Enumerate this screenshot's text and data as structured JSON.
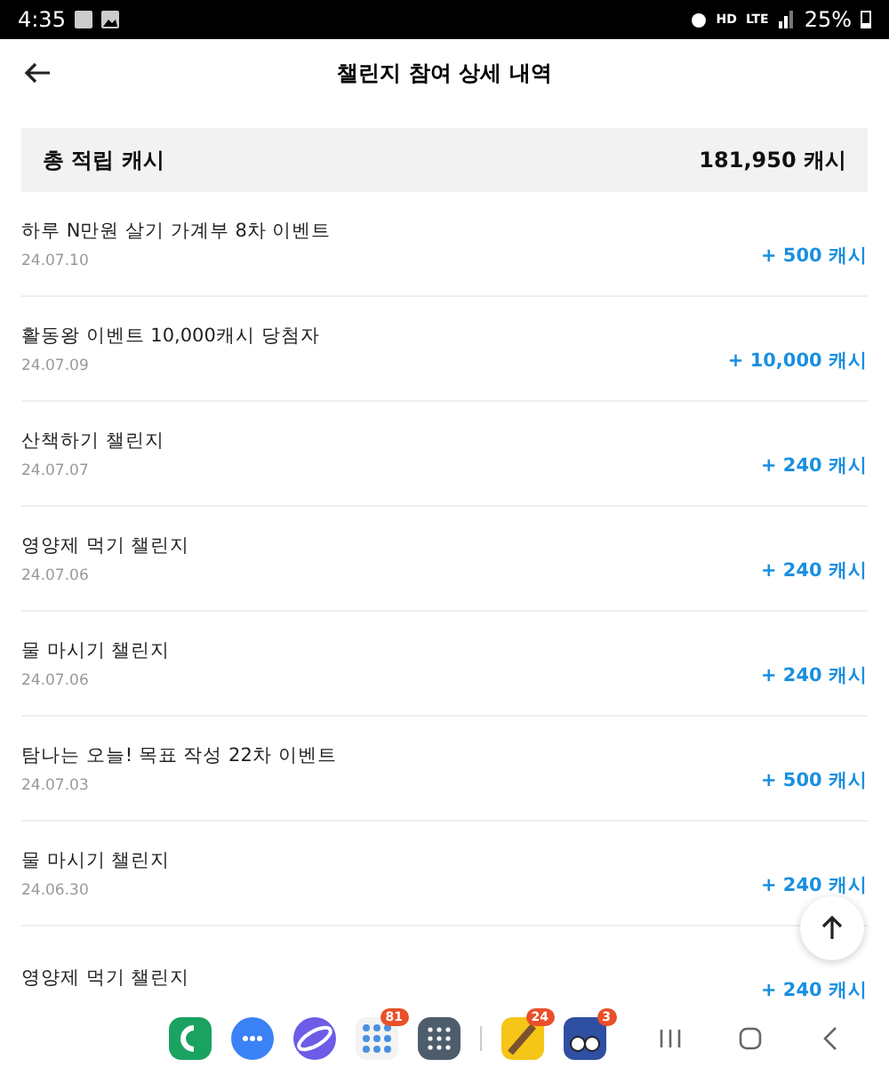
{
  "status_bar": {
    "time": "4:35",
    "network": "HD",
    "network_type": "LTE",
    "battery": "25%"
  },
  "header": {
    "title": "챌린지 참여 상세 내역"
  },
  "summary": {
    "label": "총 적립 캐시",
    "value": "181,950 캐시"
  },
  "entries": [
    {
      "title": "하루 N만원 살기 가계부 8차 이벤트",
      "date": "24.07.10",
      "amount": "+ 500 캐시"
    },
    {
      "title": "활동왕 이벤트 10,000캐시 당첨자",
      "date": "24.07.09",
      "amount": "+ 10,000 캐시"
    },
    {
      "title": "산책하기 챌린지",
      "date": "24.07.07",
      "amount": "+ 240 캐시"
    },
    {
      "title": "영양제 먹기 챌린지",
      "date": "24.07.06",
      "amount": "+ 240 캐시"
    },
    {
      "title": "물 마시기 챌린지",
      "date": "24.07.06",
      "amount": "+ 240 캐시"
    },
    {
      "title": "탐나는 오늘! 목표 작성 22차 이벤트",
      "date": "24.07.03",
      "amount": "+ 500 캐시"
    },
    {
      "title": "물 마시기 챌린지",
      "date": "24.06.30",
      "amount": "+ 240 캐시"
    },
    {
      "title": "영양제 먹기 챌린지",
      "amount": "+ 240 캐시"
    }
  ],
  "dock": [
    {
      "kind": "phone"
    },
    {
      "kind": "messages"
    },
    {
      "kind": "browser"
    },
    {
      "kind": "folder",
      "badge": "81"
    },
    {
      "kind": "apps"
    },
    {
      "kind": "divider"
    },
    {
      "kind": "game",
      "badge": "24"
    },
    {
      "kind": "owl",
      "badge": "3"
    }
  ]
}
